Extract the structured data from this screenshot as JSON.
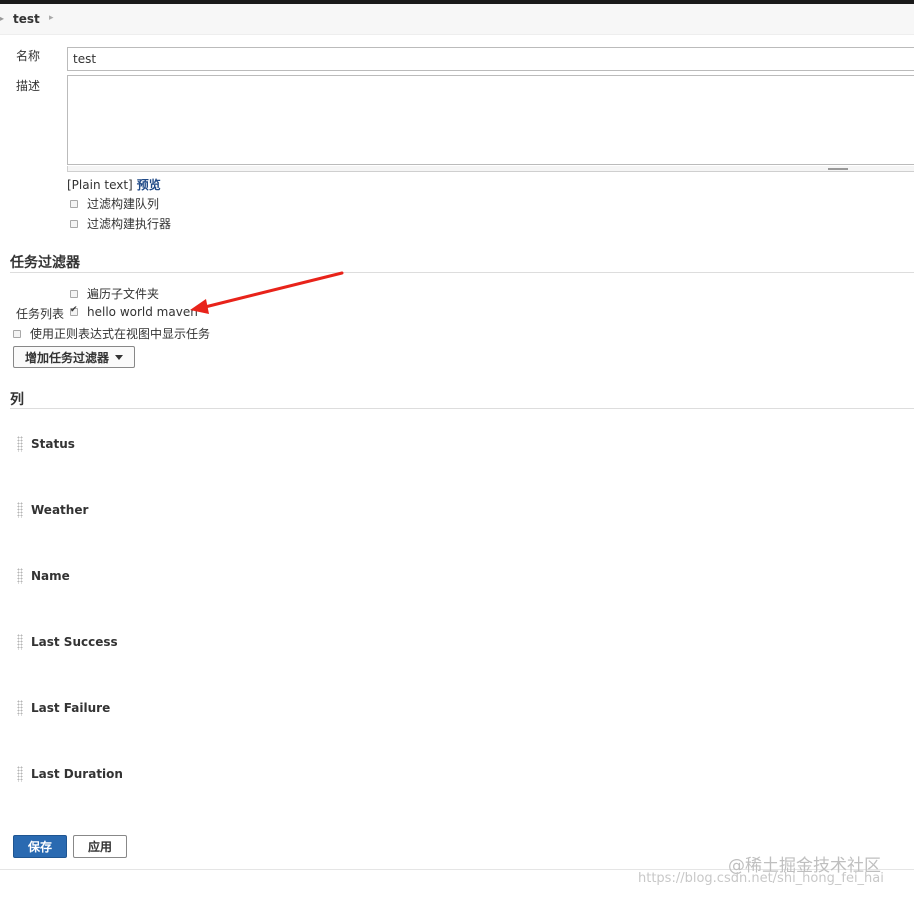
{
  "breadcrumb": {
    "item": "test"
  },
  "form": {
    "name_label": "名称",
    "name_value": "test",
    "desc_label": "描述",
    "markup_text": "[Plain text]",
    "preview_link": "预览",
    "filter_queue_label": "过滤构建队列",
    "filter_executor_label": "过滤构建执行器"
  },
  "job_filter": {
    "title": "任务过滤器",
    "recurse_label": "遍历子文件夹",
    "job_list_label": "任务列表",
    "job_item": "hello world maven",
    "regex_label": "使用正则表达式在视图中显示任务",
    "add_filter_button": "增加任务过滤器"
  },
  "columns": {
    "title": "列",
    "items": [
      "Status",
      "Weather",
      "Name",
      "Last Success",
      "Last Failure",
      "Last Duration"
    ]
  },
  "actions": {
    "save": "保存",
    "apply": "应用"
  },
  "watermark": {
    "line1": "@稀土掘金技术社区",
    "line2": "https://blog.csdn.net/shi_hong_fei_hai"
  },
  "states": {
    "filter_queue": false,
    "filter_executor": false,
    "recurse": false,
    "job_checked": true,
    "regex": false
  },
  "colors": {
    "primary_button": "#2a6ab1",
    "arrow": "#e8231a",
    "link": "#204a87"
  }
}
